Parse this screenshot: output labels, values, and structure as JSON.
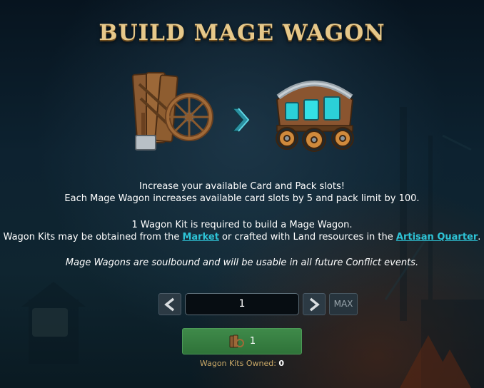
{
  "title": "BUILD MAGE WAGON",
  "description": {
    "line1": "Increase your available Card and Pack slots!",
    "line2": "Each Mage Wagon increases available card slots by 5 and pack limit by 100.",
    "kit_required": "1 Wagon Kit is required to build a Mage Wagon.",
    "obtain_prefix": "Wagon Kits may be obtained from the ",
    "market_link": "Market",
    "obtain_middle": " or crafted with Land resources in the ",
    "artisan_link": "Artisan Quarter",
    "obtain_suffix": ".",
    "soulbound_note": "Mage Wagons are soulbound and will be usable in all future Conflict events."
  },
  "stepper": {
    "quantity": "1",
    "max_label": "MAX"
  },
  "build_button": {
    "cost": "1"
  },
  "owned": {
    "label": "Wagon Kits Owned: ",
    "value": "0"
  },
  "icons": {
    "kit": "wagon-kit-icon",
    "arrow": "chevron-right-icon",
    "wagon": "mage-wagon-icon"
  },
  "colors": {
    "title": "#e6c88a",
    "link": "#2ec3d6",
    "build_button": "#3a8444",
    "owned_label": "#c8a766"
  }
}
